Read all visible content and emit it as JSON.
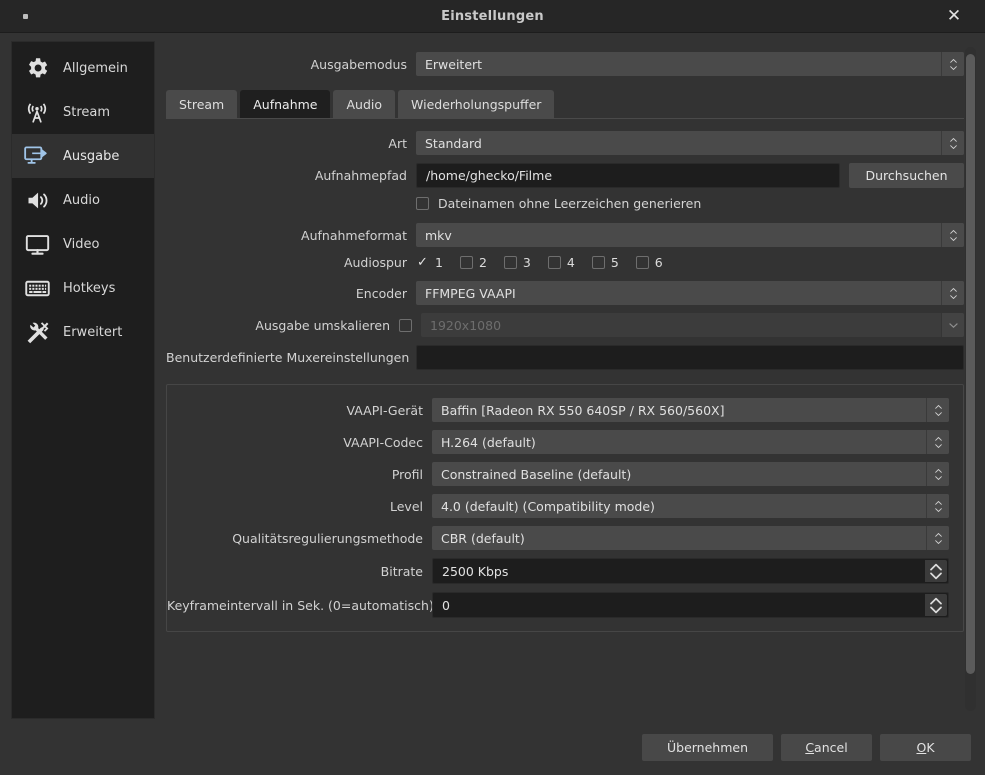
{
  "window": {
    "title": "Einstellungen",
    "close_icon": "close-icon"
  },
  "sidebar": {
    "items": [
      {
        "label": "Allgemein",
        "icon": "gear-icon",
        "selected": false
      },
      {
        "label": "Stream",
        "icon": "broadcast-icon",
        "selected": false
      },
      {
        "label": "Ausgabe",
        "icon": "monitor-arrow-icon",
        "selected": true
      },
      {
        "label": "Audio",
        "icon": "speaker-icon",
        "selected": false
      },
      {
        "label": "Video",
        "icon": "display-icon",
        "selected": false
      },
      {
        "label": "Hotkeys",
        "icon": "keyboard-icon",
        "selected": false
      },
      {
        "label": "Erweitert",
        "icon": "tools-icon",
        "selected": false
      }
    ]
  },
  "output_mode": {
    "label": "Ausgabemodus",
    "value": "Erweitert"
  },
  "tabs": [
    {
      "label": "Stream",
      "active": false
    },
    {
      "label": "Aufnahme",
      "active": true
    },
    {
      "label": "Audio",
      "active": false
    },
    {
      "label": "Wiederholungspuffer",
      "active": false
    }
  ],
  "recording": {
    "type": {
      "label": "Art",
      "value": "Standard"
    },
    "path": {
      "label": "Aufnahmepfad",
      "value": "/home/ghecko/Filme",
      "browse_button": "Durchsuchen"
    },
    "no_space_filenames": {
      "label": "Dateinamen ohne Leerzeichen generieren",
      "checked": false
    },
    "format": {
      "label": "Aufnahmeformat",
      "value": "mkv"
    },
    "audio_track": {
      "label": "Audiospur",
      "tracks": [
        {
          "number": "1",
          "checked": true
        },
        {
          "number": "2",
          "checked": false
        },
        {
          "number": "3",
          "checked": false
        },
        {
          "number": "4",
          "checked": false
        },
        {
          "number": "5",
          "checked": false
        },
        {
          "number": "6",
          "checked": false
        }
      ]
    },
    "encoder": {
      "label": "Encoder",
      "value": "FFMPEG VAAPI"
    },
    "rescale": {
      "label": "Ausgabe umskalieren",
      "checked": false,
      "value": "1920x1080",
      "disabled": true
    },
    "muxer": {
      "label": "Benutzerdefinierte Muxereinstellungen",
      "value": "",
      "placeholder": ""
    }
  },
  "encoder_settings": {
    "vaapi_device": {
      "label": "VAAPI-Gerät",
      "value": "Baffin [Radeon RX 550 640SP / RX 560/560X]"
    },
    "vaapi_codec": {
      "label": "VAAPI-Codec",
      "value": "H.264 (default)"
    },
    "profile": {
      "label": "Profil",
      "value": "Constrained Baseline (default)"
    },
    "level": {
      "label": "Level",
      "value": "4.0 (default) (Compatibility mode)"
    },
    "rate_control": {
      "label": "Qualitätsregulierungsmethode",
      "value": "CBR (default)"
    },
    "bitrate": {
      "label": "Bitrate",
      "value": "2500 Kbps"
    },
    "keyframe": {
      "label": "Keyframeintervall in Sek. (0=automatisch)",
      "value": "0"
    }
  },
  "footer": {
    "apply": "Übernehmen",
    "cancel_pre": "",
    "cancel_mn": "C",
    "cancel_post": "ancel",
    "ok_mn": "O",
    "ok_post": "K"
  },
  "colors": {
    "window_bg": "#333333",
    "titlebar_bg": "#262626",
    "sidebar_bg": "#1e1e1e",
    "selected_bg": "#313131",
    "accent_icon": "#9fc4e8",
    "combo_bg": "#4a4a4a",
    "input_bg": "#1d1d1d"
  }
}
